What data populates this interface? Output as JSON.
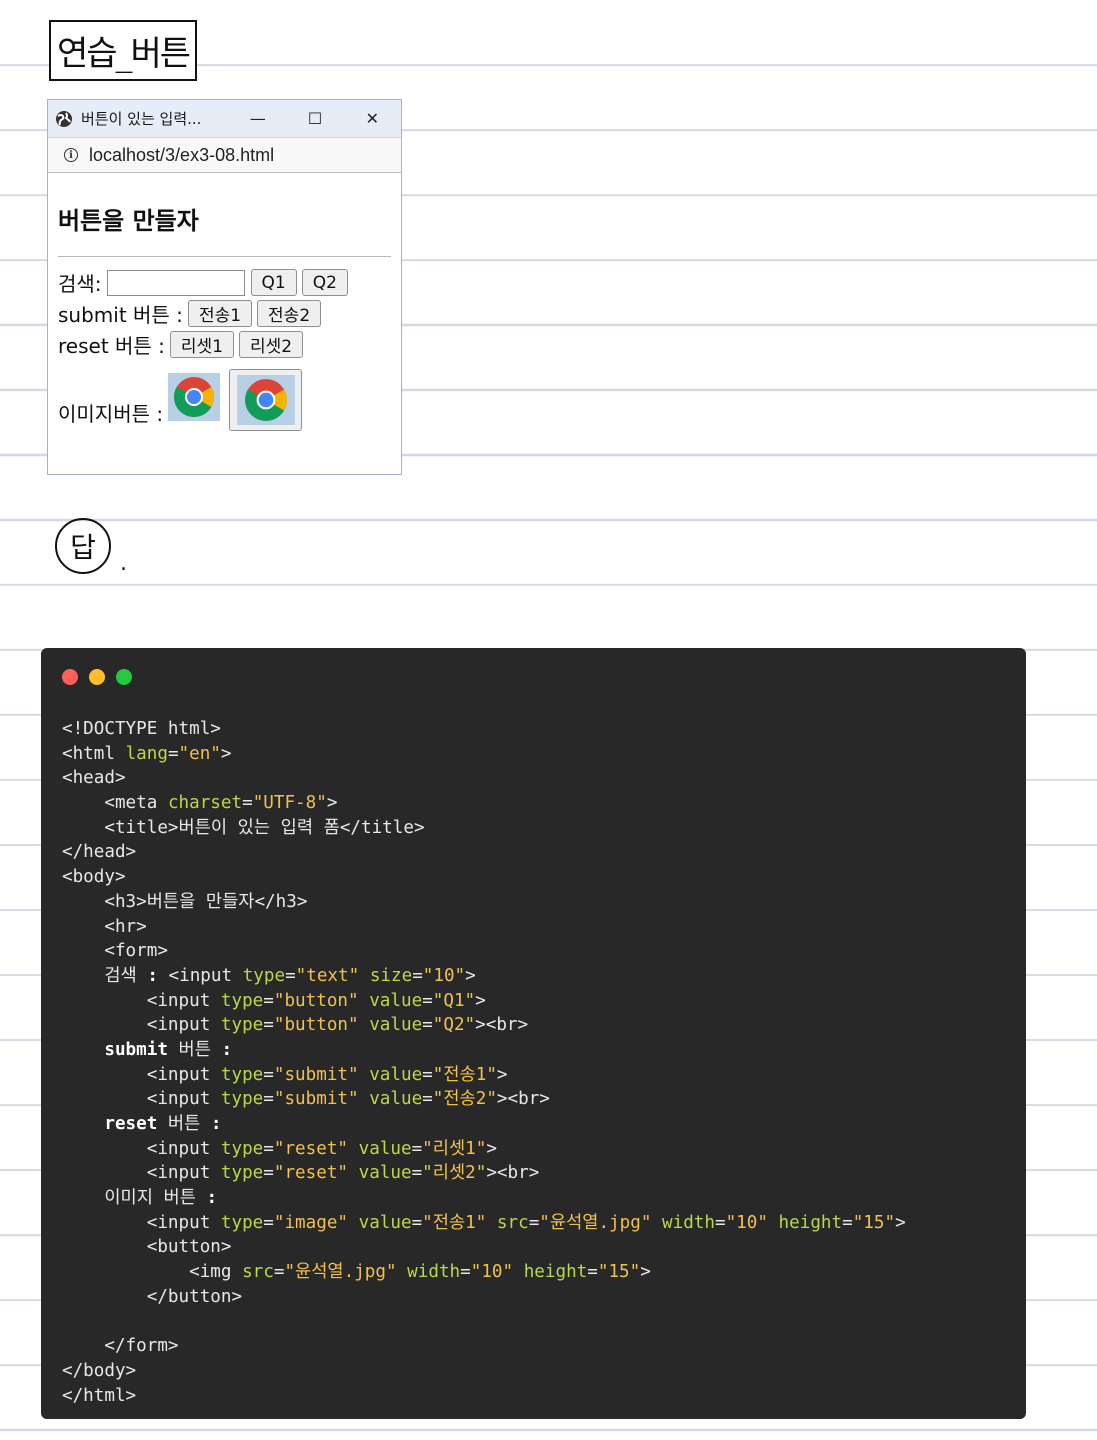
{
  "note": {
    "title": "연습_버튼",
    "answer_mark": "답",
    "answer_suffix": "."
  },
  "browser": {
    "tab_title": "버튼이 있는 입력...",
    "controls": {
      "minimize": "—",
      "maximize": "☐",
      "close": "✕"
    },
    "url": "localhost/3/ex3-08.html",
    "heading": "버튼을 만들자",
    "rows": {
      "search_label": "검색:",
      "q1": "Q1",
      "q2": "Q2",
      "submit_label": "submit 버튼 :",
      "submit1": "전송1",
      "submit2": "전송2",
      "reset_label": "reset 버튼 :",
      "reset1": "리셋1",
      "reset2": "리셋2",
      "image_label": "이미지버튼 :"
    }
  },
  "code_panel": {
    "dot_colors": [
      "#ff5f56",
      "#ffbd2e",
      "#27c93f"
    ],
    "lines": [
      [
        [
          "tag",
          "<!DOCTYPE html>"
        ]
      ],
      [
        [
          "tag",
          "<html "
        ],
        [
          "attr",
          "lang"
        ],
        [
          "tag",
          "="
        ],
        [
          "str",
          "\"en\""
        ],
        [
          "tag",
          ">"
        ]
      ],
      [
        [
          "tag",
          "<head>"
        ]
      ],
      [
        [
          "tag",
          "    <meta "
        ],
        [
          "attr",
          "charset"
        ],
        [
          "tag",
          "="
        ],
        [
          "str",
          "\"UTF-8\""
        ],
        [
          "tag",
          ">"
        ]
      ],
      [
        [
          "tag",
          "    <title>"
        ],
        [
          "txt",
          "버튼이 있는 입력 폼"
        ],
        [
          "tag",
          "</title>"
        ]
      ],
      [
        [
          "tag",
          "</head>"
        ]
      ],
      [
        [
          "tag",
          "<body>"
        ]
      ],
      [
        [
          "tag",
          "    <h3>"
        ],
        [
          "txt",
          "버튼을 만들자"
        ],
        [
          "tag",
          "</h3>"
        ]
      ],
      [
        [
          "tag",
          "    <hr>"
        ]
      ],
      [
        [
          "tag",
          "    <form>"
        ]
      ],
      [
        [
          "txt",
          "    검색 "
        ],
        [
          "kw",
          ":"
        ],
        [
          "tag",
          " <input "
        ],
        [
          "attr",
          "type"
        ],
        [
          "tag",
          "="
        ],
        [
          "str",
          "\"text\""
        ],
        [
          "tag",
          " "
        ],
        [
          "attr",
          "size"
        ],
        [
          "tag",
          "="
        ],
        [
          "str",
          "\"10\""
        ],
        [
          "tag",
          ">"
        ]
      ],
      [
        [
          "tag",
          "        <input "
        ],
        [
          "attr",
          "type"
        ],
        [
          "tag",
          "="
        ],
        [
          "str",
          "\"button\""
        ],
        [
          "tag",
          " "
        ],
        [
          "attr",
          "value"
        ],
        [
          "tag",
          "="
        ],
        [
          "str",
          "\"Q1\""
        ],
        [
          "tag",
          ">"
        ]
      ],
      [
        [
          "tag",
          "        <input "
        ],
        [
          "attr",
          "type"
        ],
        [
          "tag",
          "="
        ],
        [
          "str",
          "\"button\""
        ],
        [
          "tag",
          " "
        ],
        [
          "attr",
          "value"
        ],
        [
          "tag",
          "="
        ],
        [
          "str",
          "\"Q2\""
        ],
        [
          "tag",
          "><br>"
        ]
      ],
      [
        [
          "kw",
          "    submit"
        ],
        [
          "txt",
          " 버튼 "
        ],
        [
          "kw",
          ":"
        ]
      ],
      [
        [
          "tag",
          "        <input "
        ],
        [
          "attr",
          "type"
        ],
        [
          "tag",
          "="
        ],
        [
          "str",
          "\"submit\""
        ],
        [
          "tag",
          " "
        ],
        [
          "attr",
          "value"
        ],
        [
          "tag",
          "="
        ],
        [
          "str",
          "\"전송1\""
        ],
        [
          "tag",
          ">"
        ]
      ],
      [
        [
          "tag",
          "        <input "
        ],
        [
          "attr",
          "type"
        ],
        [
          "tag",
          "="
        ],
        [
          "str",
          "\"submit\""
        ],
        [
          "tag",
          " "
        ],
        [
          "attr",
          "value"
        ],
        [
          "tag",
          "="
        ],
        [
          "str",
          "\"전송2\""
        ],
        [
          "tag",
          "><br>"
        ]
      ],
      [
        [
          "kw",
          "    reset"
        ],
        [
          "txt",
          " 버튼 "
        ],
        [
          "kw",
          ":"
        ]
      ],
      [
        [
          "tag",
          "        <input "
        ],
        [
          "attr",
          "type"
        ],
        [
          "tag",
          "="
        ],
        [
          "str",
          "\"reset\""
        ],
        [
          "tag",
          " "
        ],
        [
          "attr",
          "value"
        ],
        [
          "tag",
          "="
        ],
        [
          "str",
          "\"리셋1\""
        ],
        [
          "tag",
          ">"
        ]
      ],
      [
        [
          "tag",
          "        <input "
        ],
        [
          "attr",
          "type"
        ],
        [
          "tag",
          "="
        ],
        [
          "str",
          "\"reset\""
        ],
        [
          "tag",
          " "
        ],
        [
          "attr",
          "value"
        ],
        [
          "tag",
          "="
        ],
        [
          "str",
          "\"리셋2\""
        ],
        [
          "tag",
          "><br>"
        ]
      ],
      [
        [
          "txt",
          "    이미지 버튼 "
        ],
        [
          "kw",
          ":"
        ]
      ],
      [
        [
          "tag",
          "        <input "
        ],
        [
          "attr",
          "type"
        ],
        [
          "tag",
          "="
        ],
        [
          "str",
          "\"image\""
        ],
        [
          "tag",
          " "
        ],
        [
          "attr",
          "value"
        ],
        [
          "tag",
          "="
        ],
        [
          "str",
          "\"전송1\""
        ],
        [
          "tag",
          " "
        ],
        [
          "attr",
          "src"
        ],
        [
          "tag",
          "="
        ],
        [
          "str",
          "\"윤석열.jpg\""
        ],
        [
          "tag",
          " "
        ],
        [
          "attr",
          "width"
        ],
        [
          "tag",
          "="
        ],
        [
          "str",
          "\"10\""
        ],
        [
          "tag",
          " "
        ],
        [
          "attr",
          "height"
        ],
        [
          "tag",
          "="
        ],
        [
          "str",
          "\"15\""
        ],
        [
          "tag",
          ">"
        ]
      ],
      [
        [
          "tag",
          "        <button>"
        ]
      ],
      [
        [
          "tag",
          "            <img "
        ],
        [
          "attr",
          "src"
        ],
        [
          "tag",
          "="
        ],
        [
          "str",
          "\"윤석열.jpg\""
        ],
        [
          "tag",
          " "
        ],
        [
          "attr",
          "width"
        ],
        [
          "tag",
          "="
        ],
        [
          "str",
          "\"10\""
        ],
        [
          "tag",
          " "
        ],
        [
          "attr",
          "height"
        ],
        [
          "tag",
          "="
        ],
        [
          "str",
          "\"15\""
        ],
        [
          "tag",
          ">"
        ]
      ],
      [
        [
          "tag",
          "        </button>"
        ]
      ],
      [
        [
          "tag",
          ""
        ]
      ],
      [
        [
          "tag",
          "    </form>"
        ]
      ],
      [
        [
          "tag",
          "</body>"
        ]
      ],
      [
        [
          "tag",
          "</html>"
        ]
      ]
    ]
  }
}
